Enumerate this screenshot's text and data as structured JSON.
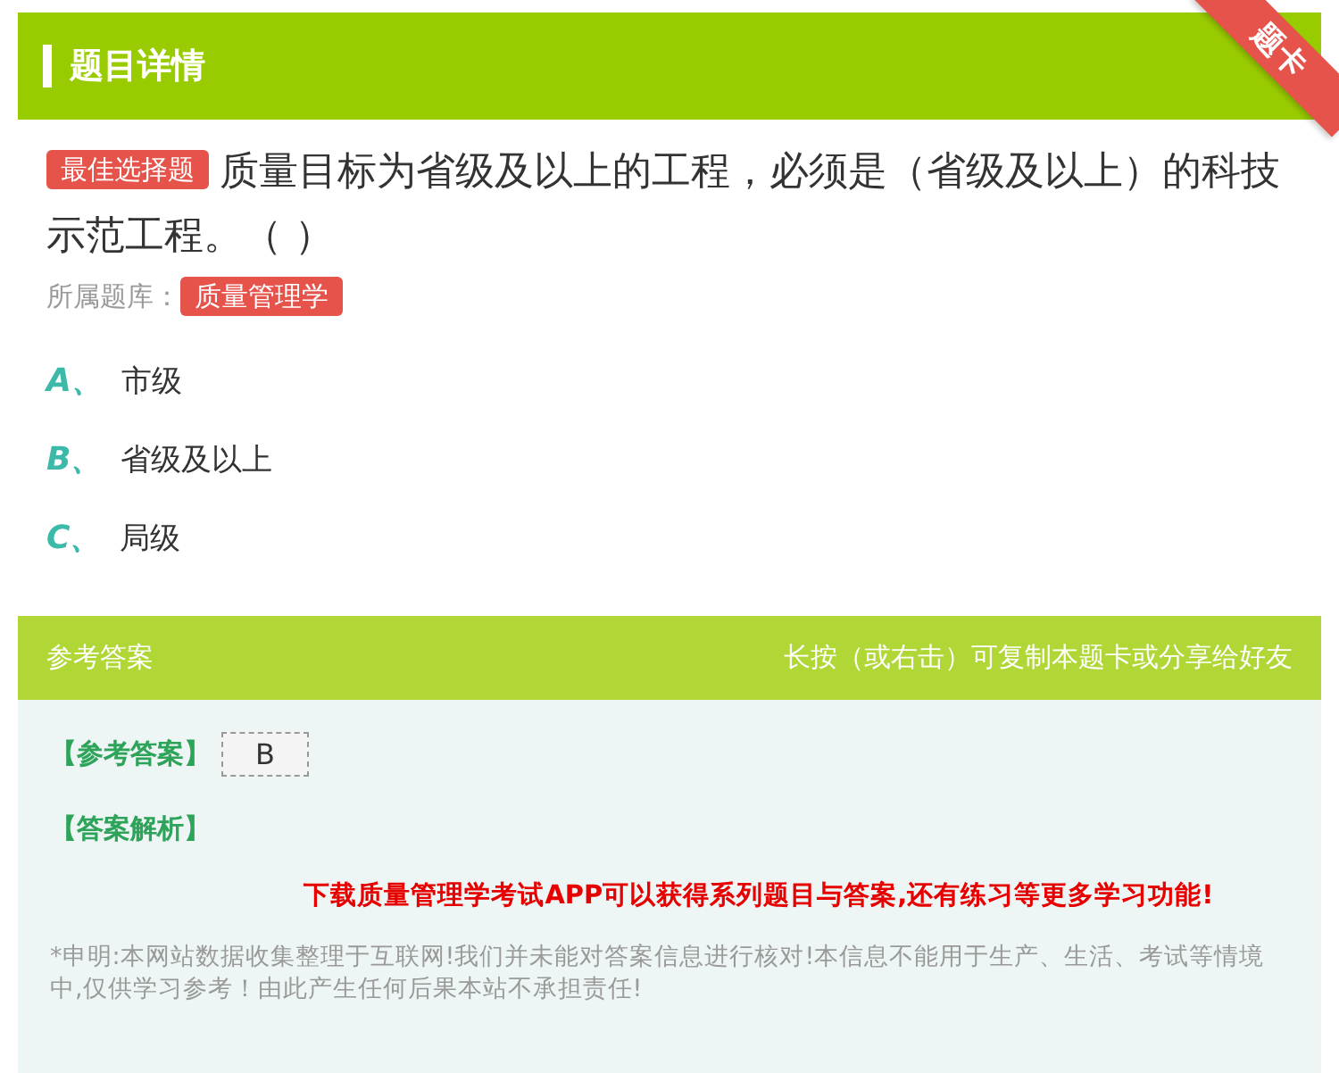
{
  "header": {
    "title": "题目详情",
    "ribbon": "题卡"
  },
  "question": {
    "type_tag": "最佳选择题",
    "text": "质量目标为省级及以上的工程，必须是（省级及以上）的科技示范工程。（ ）",
    "source_label": "所属题库：",
    "source_tag": "质量管理学"
  },
  "options": [
    {
      "letter": "A、",
      "text": "市级"
    },
    {
      "letter": "B、",
      "text": "省级及以上"
    },
    {
      "letter": "C、",
      "text": "局级"
    }
  ],
  "answer_bar": {
    "title": "参考答案",
    "hint": "长按（或右击）可复制本题卡或分享给好友"
  },
  "answer": {
    "label": "【参考答案】",
    "value": "B",
    "analysis_label": "【答案解析】",
    "promo": "下载质量管理学考试APP可以获得系列题目与答案,还有练习等更多学习功能!",
    "disclaimer": "*申明:本网站数据收集整理于互联网!我们并未能对答案信息进行核对!本信息不能用于生产、生活、考试等情境中,仅供学习参考！由此产生任何后果本站不承担责任!"
  }
}
